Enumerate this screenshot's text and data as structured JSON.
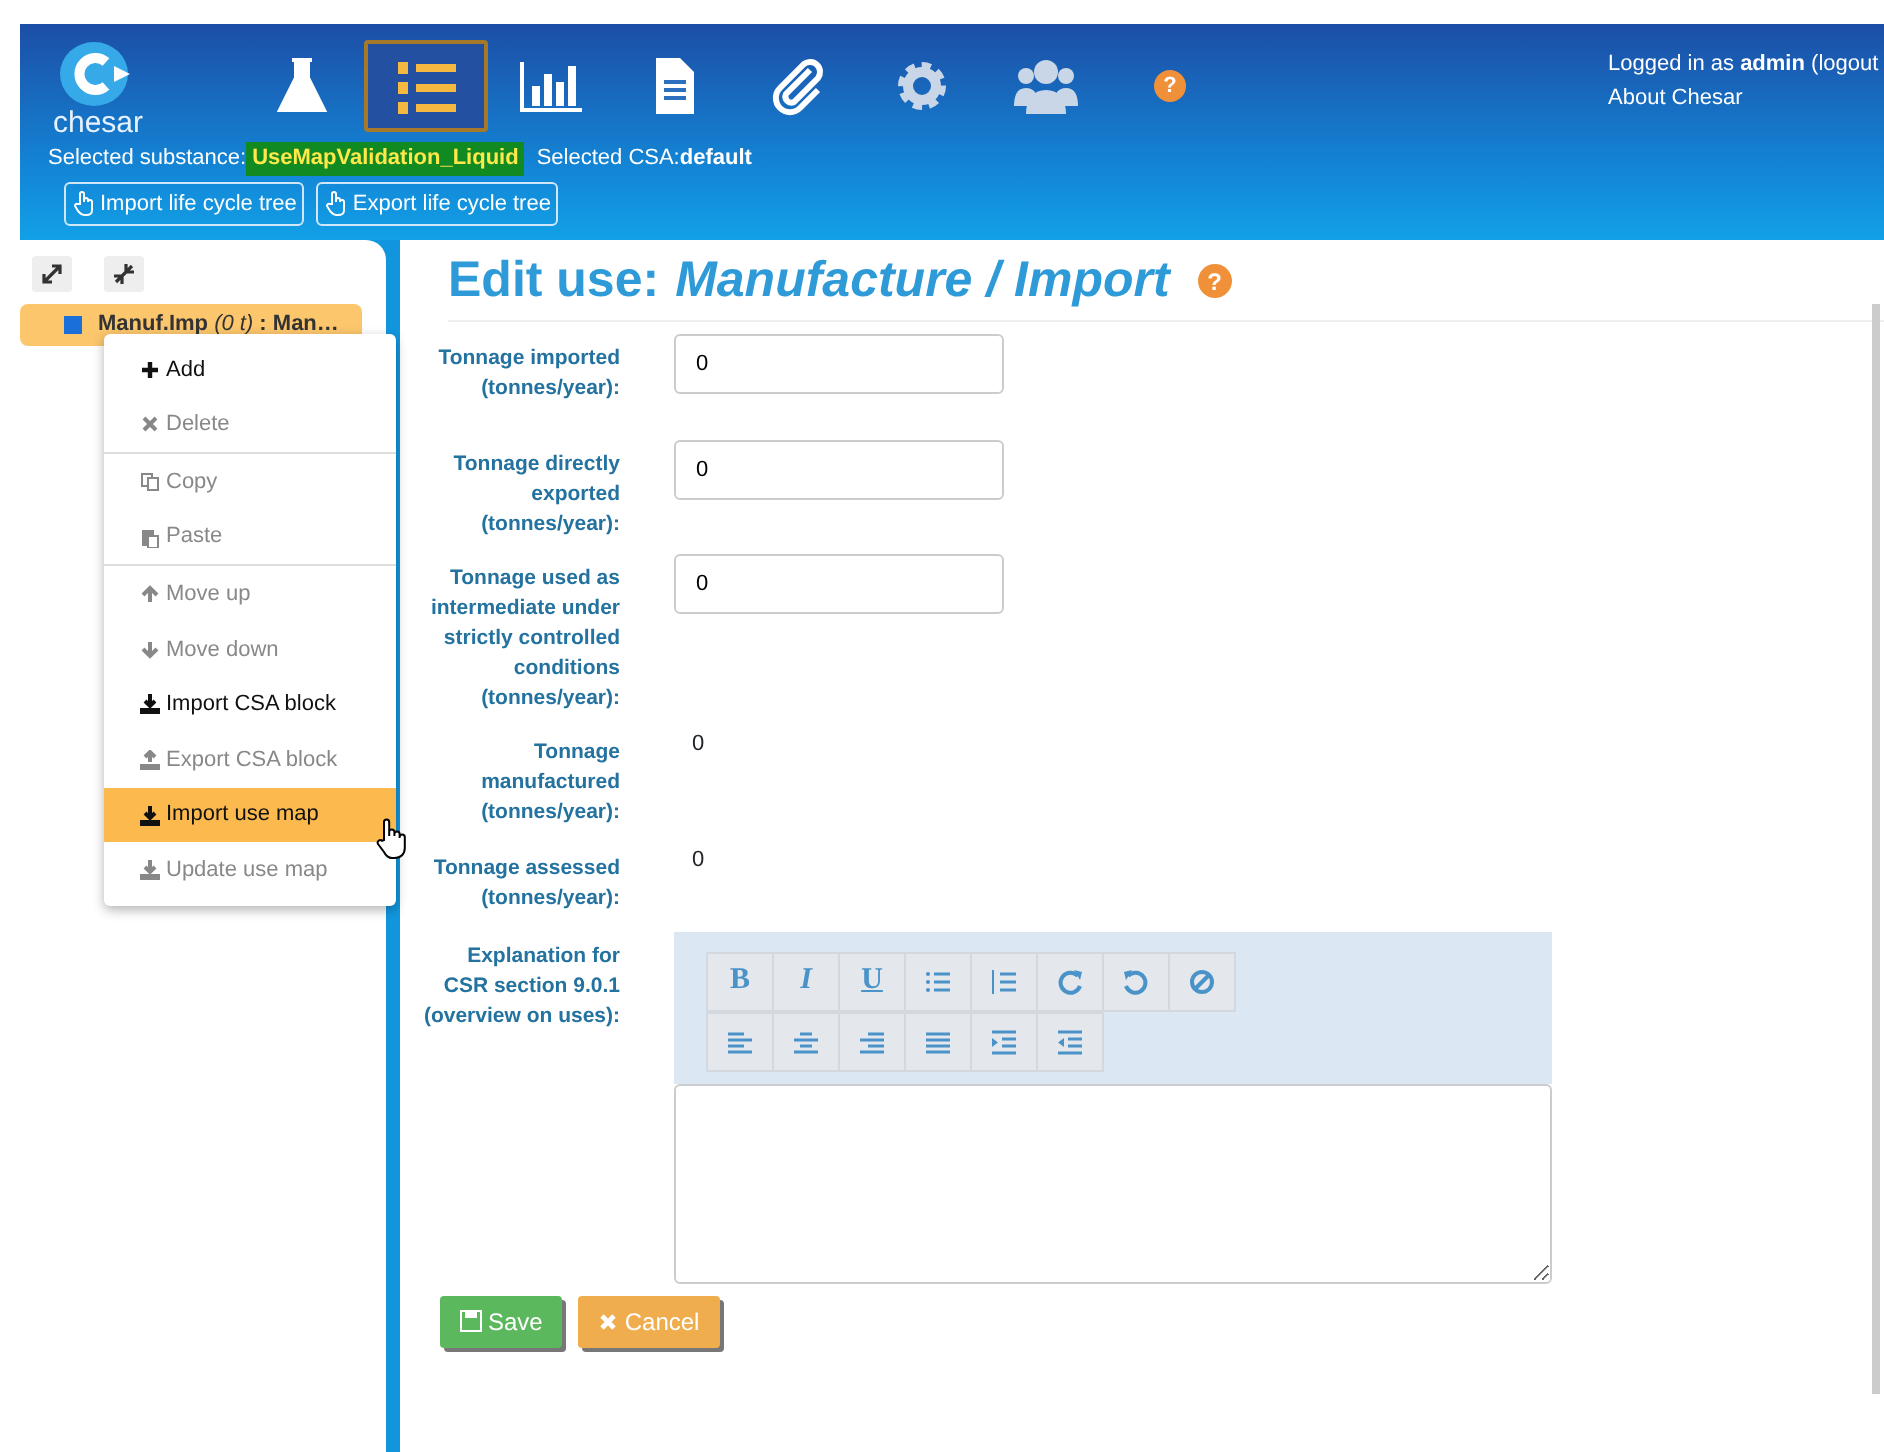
{
  "header": {
    "logo_text": "chesar",
    "nav": [
      {
        "kind": "flask",
        "selected": false
      },
      {
        "kind": "numbered-list",
        "selected": true
      },
      {
        "kind": "chart",
        "selected": false
      },
      {
        "kind": "document",
        "selected": false
      },
      {
        "kind": "paperclip",
        "selected": false
      },
      {
        "kind": "gear",
        "selected": false
      },
      {
        "kind": "users",
        "selected": false
      },
      {
        "kind": "help",
        "selected": false,
        "label": "?"
      }
    ],
    "user": "Logged in as **admin** (logout",
    "about": "About Chesar",
    "substance_label": "Selected substance:",
    "substance": "UseMapValidation_Liquid",
    "csa_label": "Selected CSA:",
    "csa": "default",
    "buttons": [
      "Import life cycle tree",
      "Export life cycle tree"
    ]
  },
  "tree": {
    "node": {
      "text": "Manuf.Imp *(0 t)* : Man…",
      "selected": true,
      "color": "#1a6fd8"
    }
  },
  "context_menu": [
    {
      "kind": "plus",
      "label": "Add",
      "disabled": false,
      "selected": false,
      "divider_before": false
    },
    {
      "kind": "cross",
      "label": "Delete",
      "disabled": true,
      "selected": false,
      "divider_before": false
    },
    {
      "kind": "copy",
      "label": "Copy",
      "disabled": true,
      "selected": false,
      "divider_before": true
    },
    {
      "kind": "paste",
      "label": "Paste",
      "disabled": true,
      "selected": false,
      "divider_before": false
    },
    {
      "kind": "up",
      "label": "Move up",
      "disabled": true,
      "selected": false,
      "divider_before": true
    },
    {
      "kind": "down",
      "label": "Move down",
      "disabled": true,
      "selected": false,
      "divider_before": false
    },
    {
      "kind": "download",
      "label": "Import CSA block",
      "disabled": false,
      "selected": false,
      "divider_before": false
    },
    {
      "kind": "upload",
      "label": "Export CSA block",
      "disabled": true,
      "selected": false,
      "divider_before": false
    },
    {
      "kind": "download",
      "label": "Import use map",
      "disabled": false,
      "selected": true,
      "divider_before": false
    },
    {
      "kind": "download",
      "label": "Update use map",
      "disabled": true,
      "selected": false,
      "divider_before": false
    }
  ],
  "form": {
    "title": "Edit use:",
    "subject": "Manufacture / Import",
    "help": "?",
    "fields": [
      {
        "kind": "input",
        "label": "Tonnage imported (tonnes/year):",
        "value": "0"
      },
      {
        "kind": "input",
        "label": "Tonnage directly exported (tonnes/year):",
        "value": "0"
      },
      {
        "kind": "input",
        "label": "Tonnage used as intermediate under strictly controlled conditions (tonnes/year):",
        "value": "0"
      },
      {
        "kind": "static",
        "label": "Tonnage manufactured (tonnes/year):",
        "value": "0"
      },
      {
        "kind": "static",
        "label": "Tonnage assessed (tonnes/year):",
        "value": "0"
      },
      {
        "kind": "editor",
        "label": "Explanation for CSR section 9.0.1 (overview on uses):"
      }
    ],
    "editor_rows": [
      [
        {
          "kind": "text",
          "label": "B"
        },
        {
          "kind": "text",
          "label": "I"
        },
        {
          "kind": "text",
          "label": "U"
        },
        {
          "kind": "bullets"
        },
        {
          "kind": "numbers"
        },
        {
          "kind": "redo"
        },
        {
          "kind": "undo"
        },
        {
          "kind": "clear"
        }
      ],
      [
        {
          "kind": "align-left"
        },
        {
          "kind": "align-center"
        },
        {
          "kind": "align-right"
        },
        {
          "kind": "justify"
        },
        {
          "kind": "indent"
        },
        {
          "kind": "outdent"
        }
      ]
    ],
    "buttons": [
      {
        "kind": "save",
        "label": "Save"
      },
      {
        "kind": "cancel",
        "label": "Cancel"
      }
    ]
  }
}
